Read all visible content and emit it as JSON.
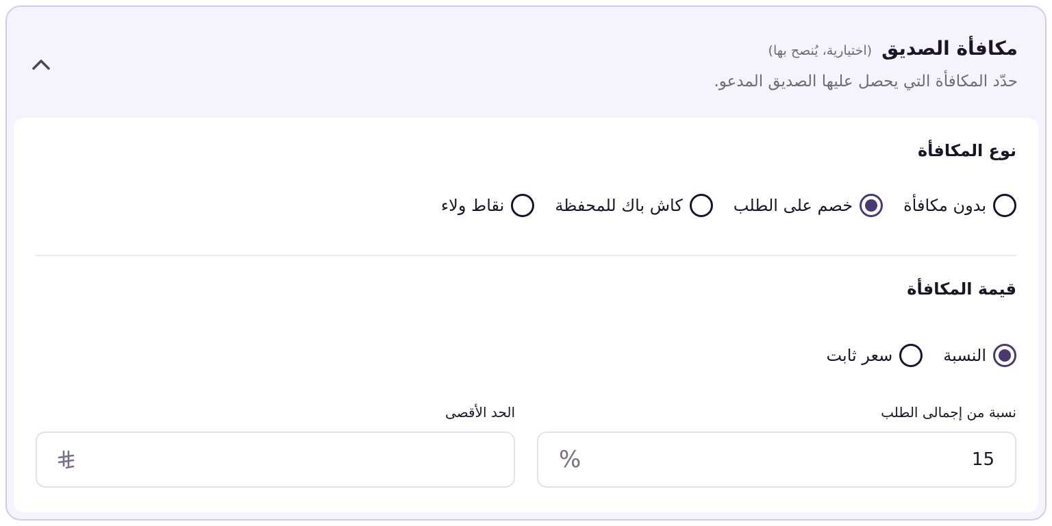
{
  "header": {
    "title": "مكافأة الصديق",
    "optional_note": "(اختيارية، يُنصح بها)",
    "subtitle": "حدّد المكافأة التي يحصل عليها الصديق المدعو."
  },
  "reward_type": {
    "label": "نوع المكافأة",
    "options": [
      {
        "label": "بدون مكافأة",
        "selected": false
      },
      {
        "label": "خصم على الطلب",
        "selected": true
      },
      {
        "label": "كاش باك للمحفظة",
        "selected": false
      },
      {
        "label": "نقاط ولاء",
        "selected": false
      }
    ]
  },
  "reward_value": {
    "label": "قيمة المكافأة",
    "options": [
      {
        "label": "النسبة",
        "selected": true
      },
      {
        "label": "سعر ثابت",
        "selected": false
      }
    ]
  },
  "percentage_field": {
    "label": "نسبة من إجمالى الطلب",
    "value": "15",
    "suffix": "%"
  },
  "max_field": {
    "label": "الحد الأقصى",
    "value": "",
    "suffix": "⃁"
  },
  "colors": {
    "accent": "#4a3870",
    "border": "#d6c7f2",
    "panel_bg": "#f5f3fb"
  }
}
